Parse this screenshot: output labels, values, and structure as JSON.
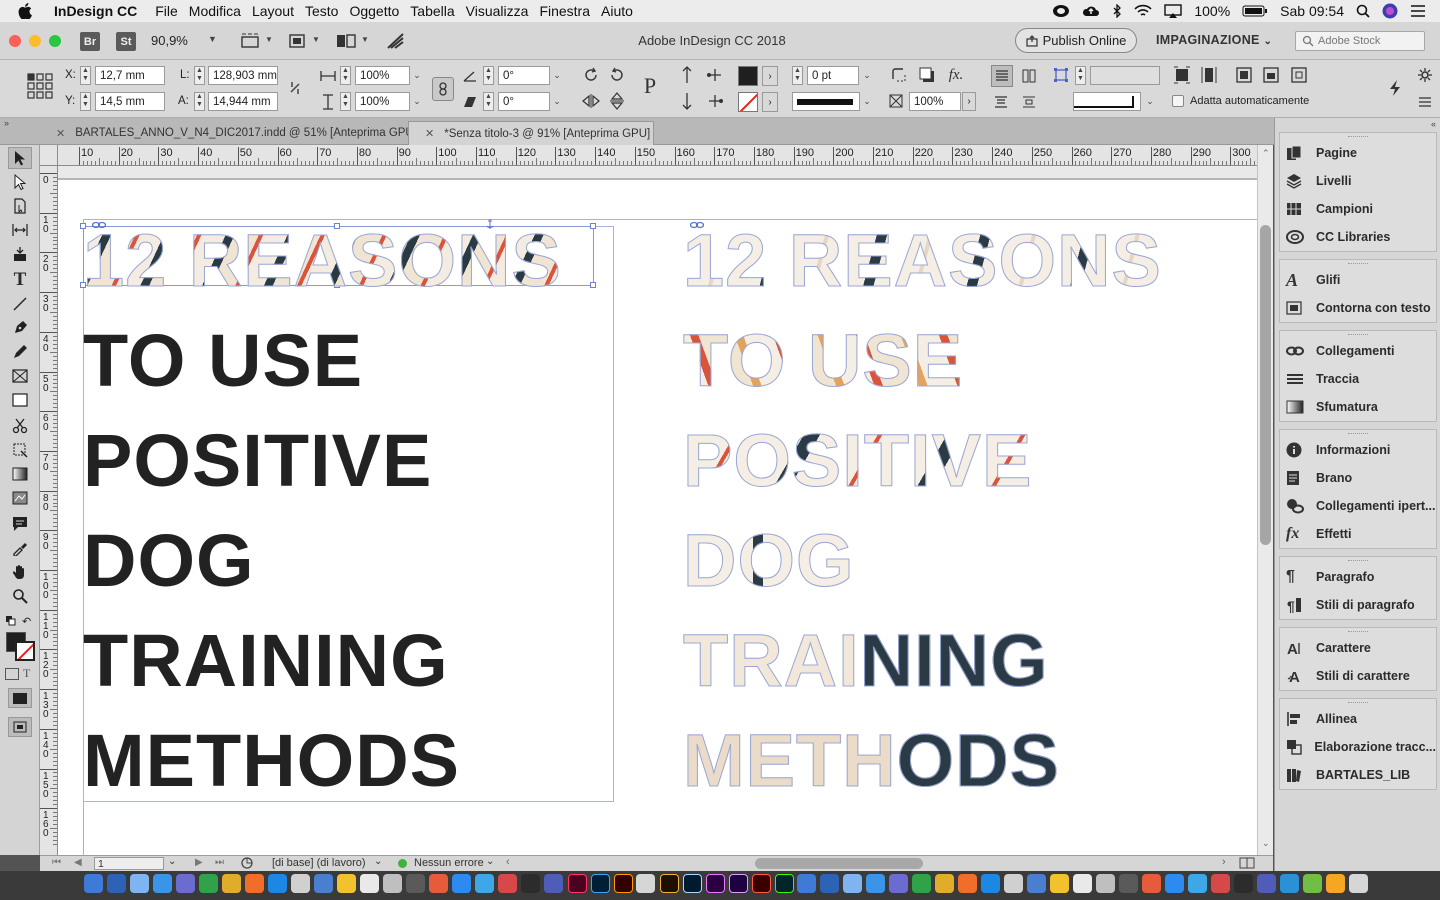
{
  "menubar": {
    "app_name": "InDesign CC",
    "menus": [
      "File",
      "Modifica",
      "Layout",
      "Testo",
      "Oggetto",
      "Tabella",
      "Visualizza",
      "Finestra",
      "Aiuto"
    ],
    "battery": "100%",
    "clock": "Sab 09:54"
  },
  "appbar": {
    "br_label": "Br",
    "st_label": "St",
    "zoom": "90,9%",
    "title": "Adobe InDesign CC 2018",
    "publish_label": "Publish Online",
    "workspace": "IMPAGINAZIONE",
    "stock_placeholder": "Adobe Stock"
  },
  "control": {
    "x_label": "X:",
    "x_value": "12,7 mm",
    "y_label": "Y:",
    "y_value": "14,5 mm",
    "l_label": "L:",
    "l_value": "128,903 mm",
    "a_label": "A:",
    "a_value": "14,944 mm",
    "scale_x": "100%",
    "scale_y": "100%",
    "rotate": "0°",
    "shear": "0°",
    "stroke_weight": "0 pt",
    "opacity": "100%",
    "autofit_label": "Adatta automaticamente"
  },
  "tabs": [
    {
      "label": "BARTALES_ANNO_V_N4_DIC2017.indd @ 51% [Anteprima GPU]",
      "active": false
    },
    {
      "label": "*Senza titolo-3 @ 91% [Anteprima GPU]",
      "active": true
    }
  ],
  "ruler_h": [
    "10",
    "20",
    "30",
    "40",
    "50",
    "60",
    "70",
    "80",
    "90",
    "100",
    "110",
    "120",
    "130",
    "140",
    "150",
    "160",
    "170",
    "180",
    "190",
    "200",
    "210",
    "220",
    "230",
    "240",
    "250",
    "260",
    "270",
    "280",
    "290",
    "300"
  ],
  "ruler_v": [
    "0",
    "1 0",
    "2 0",
    "3 0",
    "4 0",
    "5 0",
    "6 0",
    "7 0",
    "8 0",
    "9 0",
    "1 0 0",
    "1 1 0",
    "1 2 0",
    "1 3 0",
    "1 4 0",
    "1 5 0",
    "1 6 0"
  ],
  "document": {
    "lines": [
      "12 REASONS",
      "TO USE",
      "POSITIVE",
      "DOG",
      "TRAINING",
      "METHODS"
    ]
  },
  "status": {
    "page": "1",
    "master": "[di base] (di lavoro)",
    "errors": "Nessun errore"
  },
  "panels": [
    {
      "group": 1,
      "items": [
        {
          "label": "Pagine",
          "icon": "pages-icon"
        },
        {
          "label": "Livelli",
          "icon": "layers-icon"
        },
        {
          "label": "Campioni",
          "icon": "swatches-icon"
        },
        {
          "label": "CC Libraries",
          "icon": "cc-libraries-icon"
        }
      ]
    },
    {
      "group": 2,
      "items": [
        {
          "label": "Glifi",
          "icon": "glyphs-icon"
        },
        {
          "label": "Contorna con testo",
          "icon": "text-wrap-icon"
        }
      ]
    },
    {
      "group": 3,
      "items": [
        {
          "label": "Collegamenti",
          "icon": "links-icon"
        },
        {
          "label": "Traccia",
          "icon": "stroke-icon"
        },
        {
          "label": "Sfumatura",
          "icon": "gradient-icon"
        }
      ]
    },
    {
      "group": 4,
      "items": [
        {
          "label": "Informazioni",
          "icon": "info-icon"
        },
        {
          "label": "Brano",
          "icon": "story-icon"
        },
        {
          "label": "Collegamenti ipert...",
          "icon": "hyperlinks-icon"
        },
        {
          "label": "Effetti",
          "icon": "effects-icon"
        }
      ]
    },
    {
      "group": 5,
      "items": [
        {
          "label": "Paragrafo",
          "icon": "paragraph-icon"
        },
        {
          "label": "Stili di paragrafo",
          "icon": "paragraph-styles-icon"
        }
      ]
    },
    {
      "group": 6,
      "items": [
        {
          "label": "Carattere",
          "icon": "character-icon"
        },
        {
          "label": "Stili di carattere",
          "icon": "character-styles-icon"
        }
      ]
    },
    {
      "group": 7,
      "items": [
        {
          "label": "Allinea",
          "icon": "align-icon"
        },
        {
          "label": "Elaborazione tracc...",
          "icon": "pathfinder-icon"
        },
        {
          "label": "BARTALES_LIB",
          "icon": "library-icon"
        }
      ]
    }
  ],
  "colors": {
    "canvas": "#ffffff",
    "ink": "#222222",
    "frame": "#a7b3e0"
  }
}
